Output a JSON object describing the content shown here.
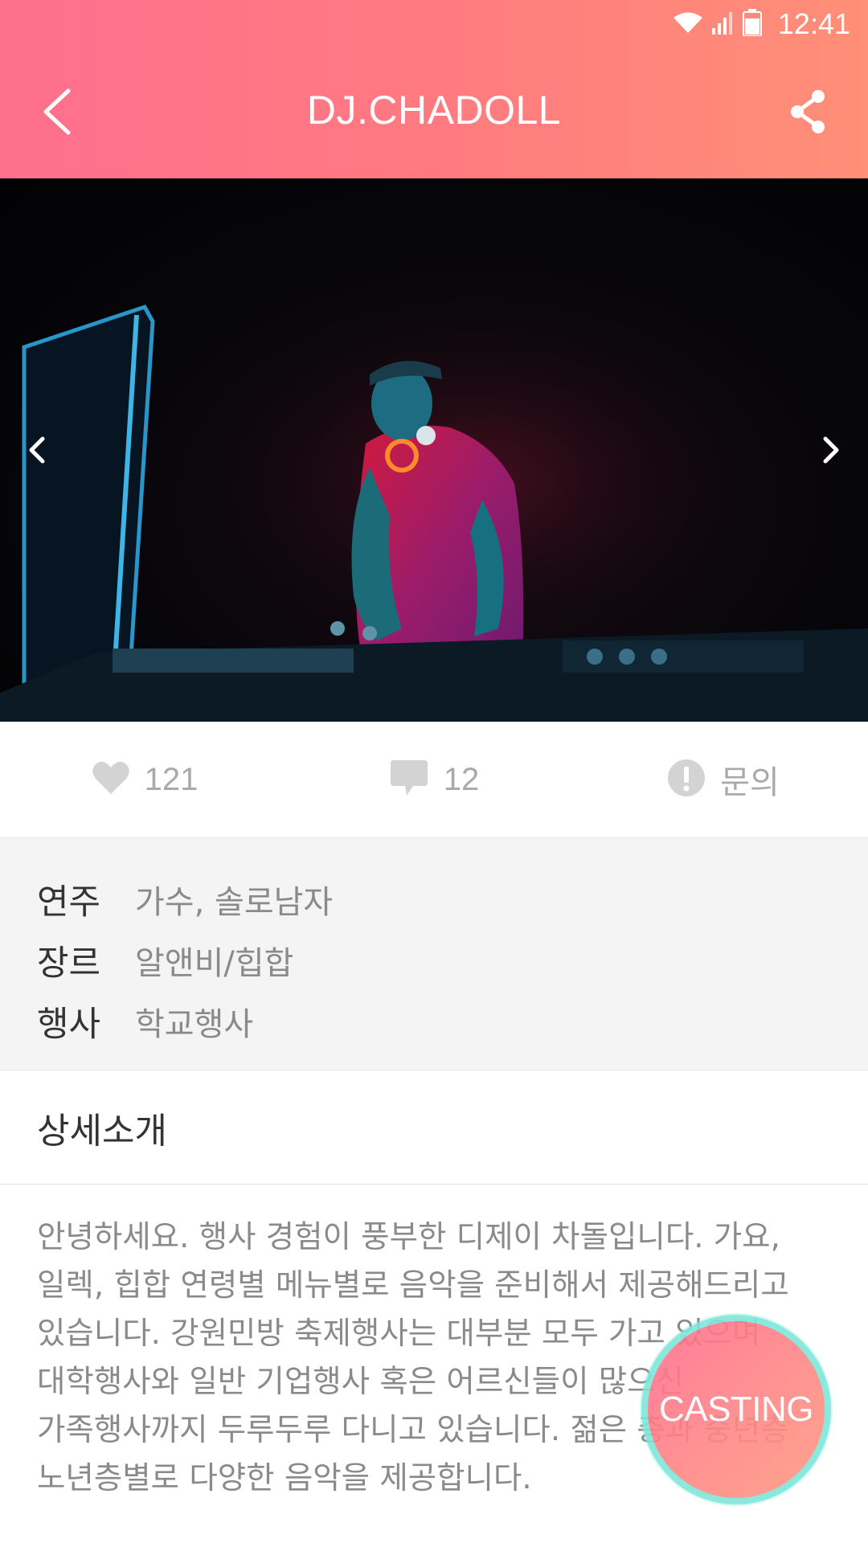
{
  "status_bar": {
    "time": "12:41"
  },
  "app_bar": {
    "title": "DJ.CHADOLL"
  },
  "hero": {
    "description_icon": "dj-performing-photo"
  },
  "stats": {
    "likes": "121",
    "comments": "12",
    "inquiry": "문의"
  },
  "info": {
    "rows": [
      {
        "label": "연주",
        "value": "가수, 솔로남자"
      },
      {
        "label": "장르",
        "value": "알앤비/힙합"
      },
      {
        "label": "행사",
        "value": "학교행사"
      }
    ]
  },
  "detail": {
    "title": "상세소개",
    "body": "안녕하세요. 행사 경험이 풍부한 디제이 차돌입니다. 가요, 일렉, 힙합 연령별 메뉴별로 음악을 준비해서 제공해드리고 있습니다. 강원민방 축제행사는 대부분 모두 가고 있으며 대학행사와 일반 기업행사 혹은 어르신들이 많으신 가족행사까지 두루두루 다니고 있습니다. 젊은 층과 중년층 노년층별로 다양한 음악을 제공합니다."
  },
  "casting_button": {
    "label": "CASTING"
  },
  "colors": {
    "header_start": "#ff6f8e",
    "header_end": "#ff8f77",
    "casting_ring": "#7fe6da",
    "muted_text": "#8a8a8a"
  }
}
